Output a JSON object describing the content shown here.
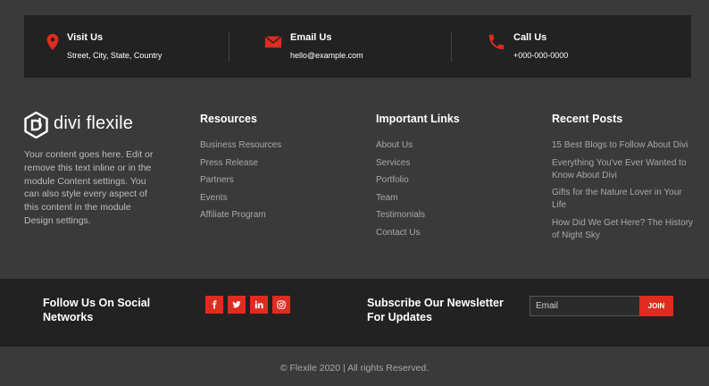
{
  "colors": {
    "accent": "#e02b20",
    "dark_band": "#222222",
    "background": "#3a3a3a"
  },
  "contacts": [
    {
      "icon": "location-pin-icon",
      "title": "Visit Us",
      "value": "Street, City, State, Country"
    },
    {
      "icon": "envelope-icon",
      "title": "Email Us",
      "value": "hello@example.com"
    },
    {
      "icon": "phone-icon",
      "title": "Call Us",
      "value": "+000-000-0000"
    }
  ],
  "brand": {
    "name": "divi flexile",
    "about": "Your content goes here. Edit or remove this text inline or in the module Content settings. You can also style every aspect of this content in the module Design settings."
  },
  "resources": {
    "title": "Resources",
    "links": [
      "Business Resources",
      "Press Release",
      "Partners",
      "Events",
      "Affiliate Program"
    ]
  },
  "important_links": {
    "title": "Important Links",
    "links": [
      "About Us",
      "Services",
      "Portfolio",
      "Team",
      "Testimonials",
      "Contact Us"
    ]
  },
  "recent_posts": {
    "title": "Recent Posts",
    "links": [
      "15 Best Blogs to Follow About Divi",
      "Everything You've Ever Wanted to Know About Divi",
      "Gifts for the Nature Lover in Your Life",
      "How Did We Get Here? The History of Night Sky"
    ]
  },
  "social": {
    "title": "Follow Us On Social Networks",
    "icons": [
      "facebook-icon",
      "twitter-icon",
      "linkedin-icon",
      "instagram-icon"
    ]
  },
  "newsletter": {
    "title": "Subscribe Our Newsletter For Updates",
    "placeholder": "Email",
    "button": "JOIN"
  },
  "footer": {
    "copyright": "© Flexile 2020 | All rights Reserved."
  }
}
